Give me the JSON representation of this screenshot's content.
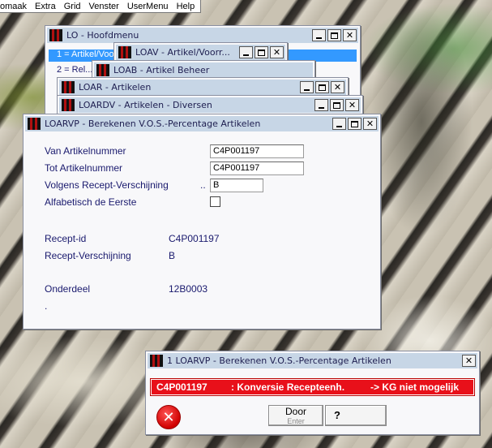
{
  "menubar": {
    "items": [
      "omaak",
      "Extra",
      "Grid",
      "Venster",
      "UserMenu",
      "Help"
    ]
  },
  "windows": {
    "main_menu": {
      "title": "LO - Hoofdmenu",
      "items": [
        "1 = Artikel/Voorr...",
        "2 = Rel..."
      ]
    },
    "loav": {
      "title": "LOAV - Artikel/Voorr..."
    },
    "loab": {
      "title": "LOAB - Artikel Beheer"
    },
    "loar": {
      "title": "LOAR - Artikelen"
    },
    "loardv": {
      "title": "LOARDV - Artikelen - Diversen"
    }
  },
  "dialog": {
    "title": "LOARVP - Berekenen V.O.S.-Percentage Artikelen",
    "fields": {
      "van_label": "Van Artikelnummer",
      "van_value": "C4P001197",
      "tot_label": "Tot Artikelnummer",
      "tot_value": "C4P001197",
      "recept_label": "Volgens Recept-Verschijning",
      "recept_dots": "..",
      "recept_value": "B",
      "alfa_label": "Alfabetisch de Eerste"
    },
    "info": {
      "recept_id_label": "Recept-id",
      "recept_id_value": "C4P001197",
      "recept_versch_label": "Recept-Verschijning",
      "recept_versch_value": "B",
      "onderdeel_label": "Onderdeel",
      "onderdeel_value": "12B0003",
      "dot": "."
    }
  },
  "error": {
    "title": "1 LOARVP - Berekenen V.O.S.-Percentage Artikelen",
    "code": "C4P001197",
    "message": ": Konversie Recepteenh.",
    "detail": "-> KG niet mogelijk",
    "door_label": "Door",
    "door_sub": "Enter",
    "help_label": "?"
  }
}
